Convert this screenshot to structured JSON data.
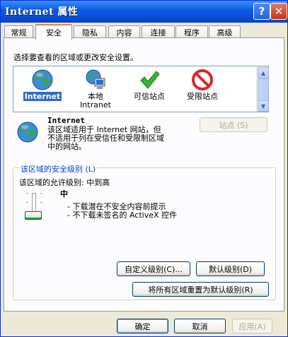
{
  "window": {
    "title": "Internet 属性"
  },
  "titlebar": {
    "help_glyph": "?",
    "close_glyph": "✕"
  },
  "tabs": [
    {
      "label": "常规"
    },
    {
      "label": "安全"
    },
    {
      "label": "隐私"
    },
    {
      "label": "内容"
    },
    {
      "label": "连接"
    },
    {
      "label": "程序"
    },
    {
      "label": "高级"
    }
  ],
  "security": {
    "instruction": "选择要查看的区域或更改安全设置。",
    "zones": [
      {
        "label": "Internet",
        "icon": "globe-icon",
        "selected": true
      },
      {
        "label_line1": "本地",
        "label_line2": "Intranet",
        "icon": "local-intranet-icon"
      },
      {
        "label": "可信站点",
        "icon": "trusted-sites-icon"
      },
      {
        "label": "受限站点",
        "icon": "restricted-sites-icon"
      }
    ],
    "zone_info": {
      "name": "Internet",
      "description_line1": "该区域适用于 Internet 网站，但",
      "description_line2": "不适用于列在受信任和受限制区域",
      "description_line3": "中的网站。"
    },
    "sites_button": "站点 (S)",
    "level_group_title": "该区域的安全级别 (L)",
    "allowed_levels": "该区域的允许级别: 中到高",
    "level_name": "中",
    "level_bullet1": "- 下载潜在不安全内容前提示",
    "level_bullet2": "- 不下载未签名的 ActiveX 控件",
    "custom_level_button": "自定义级别(C)...",
    "default_level_button": "默认级别(D)",
    "reset_all_button": "将所有区域重置为默认级别(R)"
  },
  "footer": {
    "ok": "确定",
    "cancel": "取消",
    "apply": "应用(A)"
  },
  "colors": {
    "accent": "#316ac5",
    "titlebar": "#0a5ae0",
    "group_title": "#0046d5"
  }
}
